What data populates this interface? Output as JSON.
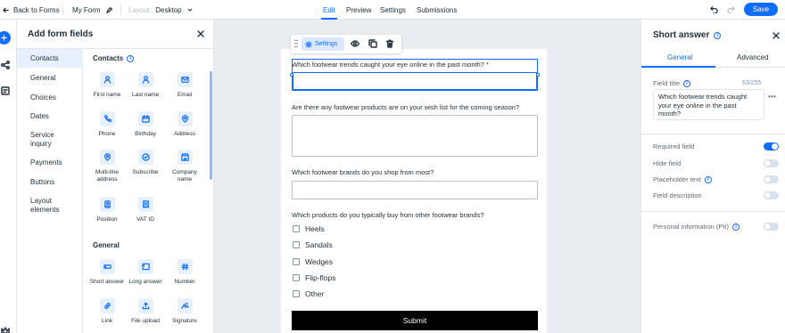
{
  "topbar": {
    "back_label": "Back to Forms",
    "form_name": "My Form",
    "layout_label": "Layout:",
    "layout_value": "Desktop",
    "tabs": [
      {
        "label": "Edit",
        "active": true
      },
      {
        "label": "Preview",
        "active": false
      },
      {
        "label": "Settings",
        "active": false
      },
      {
        "label": "Submissions",
        "active": false
      }
    ],
    "save_label": "Save",
    "icons": [
      "arrow-left-icon",
      "pencil-icon",
      "chevron-down-icon",
      "undo-icon",
      "redo-icon"
    ]
  },
  "rail": {
    "icons": [
      "plus-icon",
      "connections-icon",
      "form-settings-icon",
      "crown-icon"
    ]
  },
  "add_panel": {
    "title": "Add form fields",
    "categories": [
      "Contacts",
      "General",
      "Choices",
      "Dates",
      "Service inquiry",
      "Payments",
      "Buttons",
      "Layout elements"
    ],
    "active_category": "Contacts",
    "contacts_title": "Contacts",
    "contacts": [
      "First name",
      "Last name",
      "Email",
      "Phone",
      "Birthday",
      "Address",
      "Multi-line address",
      "Subscribe",
      "Company name",
      "Position",
      "VAT ID"
    ],
    "general_title": "General",
    "general": [
      "Short answer",
      "Long answer",
      "Number",
      "Link",
      "File upload",
      "Signature"
    ]
  },
  "form": {
    "toolbar_settings": "Settings",
    "questions": [
      "Which footwear trends caught your eye online in the past month? *",
      "Are there any footwear products are on your wish list for the coming season?",
      "Which footwear brands do you shop from most?",
      "Which products do you typically buy from other footwear brands?"
    ],
    "options": [
      "Heels",
      "Sandals",
      "Wedges",
      "Flip-flops",
      "Other"
    ],
    "submit_label": "Submit"
  },
  "right_panel": {
    "title": "Short answer",
    "tabs": [
      "General",
      "Advanced"
    ],
    "active_tab": "General",
    "field_title_label": "Field title",
    "char_count": "63/255",
    "field_title_value": "Which footwear trends caught your eye online in the past month?",
    "toggles": [
      {
        "label": "Required field",
        "on": true,
        "info": false
      },
      {
        "label": "Hide field",
        "on": false,
        "info": false
      },
      {
        "label": "Placeholder text",
        "on": false,
        "info": true
      },
      {
        "label": "Field description",
        "on": false,
        "info": false
      }
    ],
    "pii": {
      "label": "Personal information (PII)",
      "on": false
    }
  },
  "colors": {
    "accent": "#116dff",
    "tile_bg": "#e7f0ff",
    "canvas_bg": "#e9ecf0",
    "submit_bg": "#000000"
  }
}
